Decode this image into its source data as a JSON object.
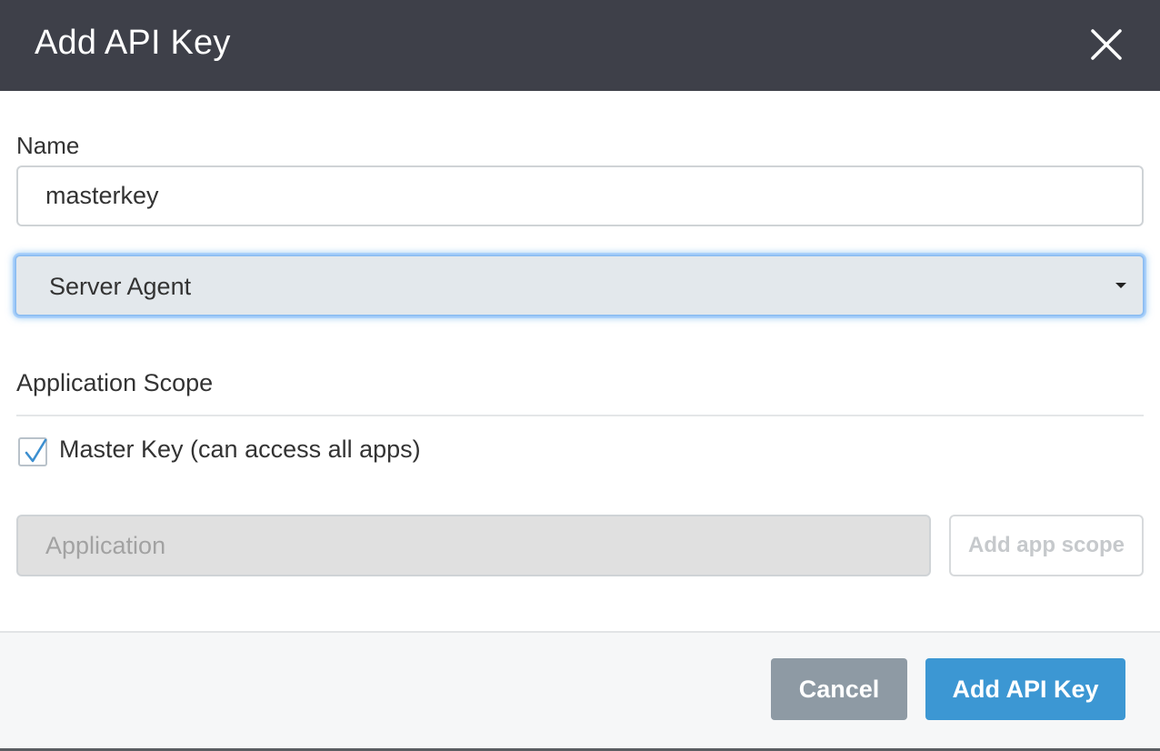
{
  "modal": {
    "title": "Add API Key",
    "close_icon": "close-icon"
  },
  "form": {
    "name": {
      "label": "Name",
      "value": "masterkey"
    },
    "type_select": {
      "selected": "Server Agent",
      "icon": "caret-down-icon"
    },
    "scope": {
      "heading": "Application Scope",
      "master_key": {
        "label": "Master Key (can access all apps)",
        "checked": true,
        "icon": "checkmark-icon"
      },
      "application": {
        "placeholder": "Application",
        "value": ""
      },
      "add_scope_label": "Add app scope"
    }
  },
  "footer": {
    "cancel_label": "Cancel",
    "submit_label": "Add API Key"
  },
  "colors": {
    "header_bg": "#3e4049",
    "primary": "#3c97d3",
    "secondary": "#8e9aa4",
    "focus_ring": "#8fbff2",
    "checkmark": "#3c8fd0"
  }
}
